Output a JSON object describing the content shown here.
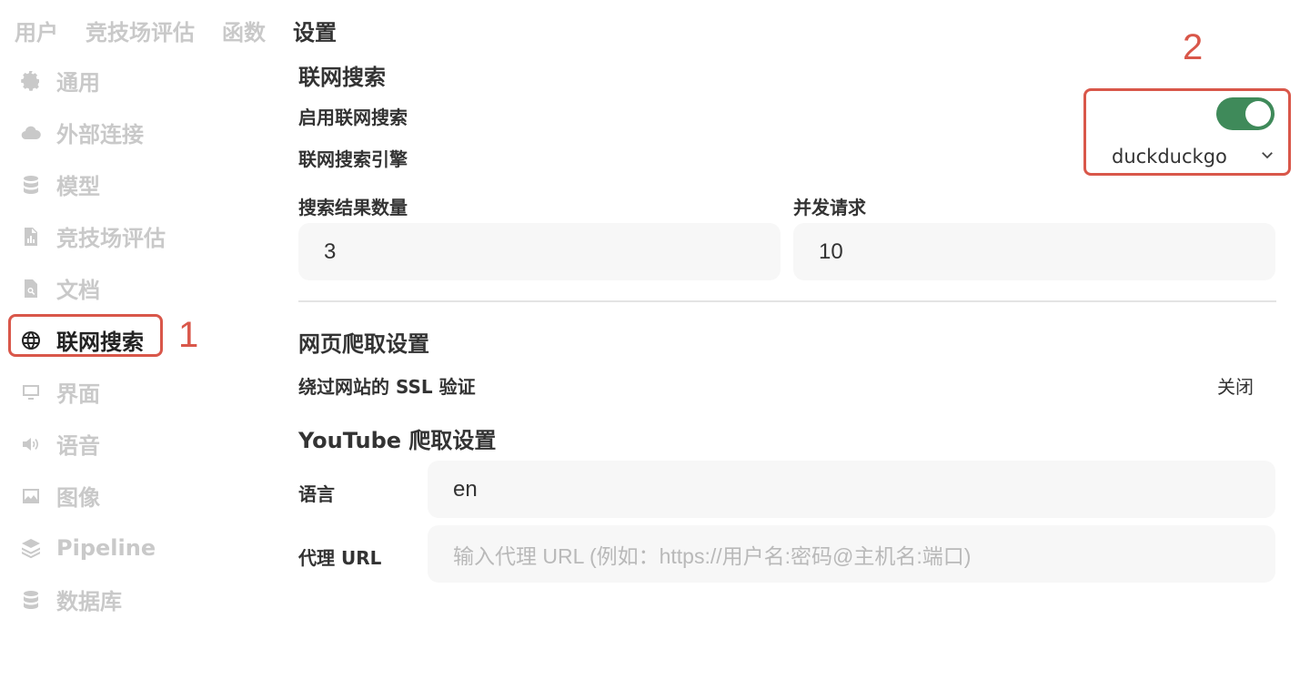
{
  "top_tabs": [
    "用户",
    "竞技场评估",
    "函数",
    "设置"
  ],
  "sidebar": {
    "items": [
      {
        "label": "通用",
        "icon": "gear-icon"
      },
      {
        "label": "外部连接",
        "icon": "cloud-icon"
      },
      {
        "label": "模型",
        "icon": "database-icon"
      },
      {
        "label": "竞技场评估",
        "icon": "chart-document-icon"
      },
      {
        "label": "文档",
        "icon": "search-document-icon"
      },
      {
        "label": "联网搜索",
        "icon": "globe-icon"
      },
      {
        "label": "界面",
        "icon": "monitor-icon"
      },
      {
        "label": "语音",
        "icon": "speaker-icon"
      },
      {
        "label": "图像",
        "icon": "image-icon"
      },
      {
        "label": "Pipeline",
        "icon": "layers-icon"
      },
      {
        "label": "数据库",
        "icon": "database-icon"
      }
    ],
    "active": "联网搜索"
  },
  "annotations": {
    "one": "1",
    "two": "2",
    "color": "#d9574a"
  },
  "web_search": {
    "section_title": "联网搜索",
    "enable_label": "启用联网搜索",
    "enable_state": true,
    "engine_label": "联网搜索引擎",
    "engine_value": "duckduckgo",
    "result_count_label": "搜索结果数量",
    "result_count_value": "3",
    "concurrency_label": "并发请求",
    "concurrency_value": "10"
  },
  "crawl": {
    "section_title": "网页爬取设置",
    "ssl_label": "绕过网站的 SSL 验证",
    "ssl_value": "关闭"
  },
  "youtube": {
    "section_title": "YouTube 爬取设置",
    "language_label": "语言",
    "language_value": "en",
    "proxy_label": "代理 URL",
    "proxy_placeholder": "输入代理 URL (例如：https://用户名:密码@主机名:端口)"
  },
  "colors": {
    "toggle_on": "#3f8a5a",
    "highlight": "#d9574a"
  }
}
